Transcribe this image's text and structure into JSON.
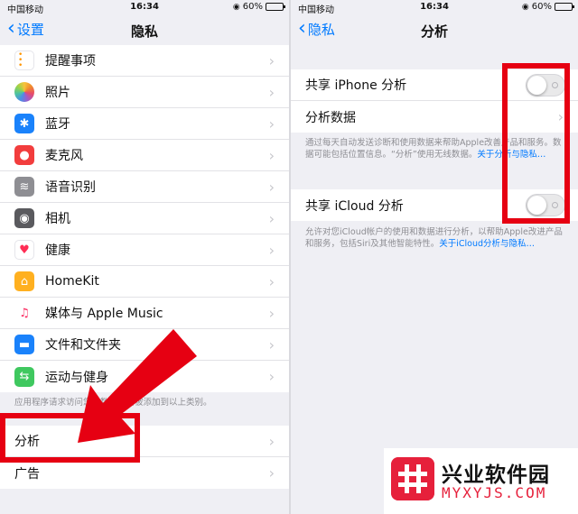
{
  "status_bar": {
    "left_panel": {
      "carrier": "中国移动",
      "time": "16:34",
      "battery": "60%",
      "battery_level": 0.6
    },
    "right_panel": {
      "carrier": "中国移动",
      "time": "16:34",
      "battery": "60%",
      "battery_level": 0.6
    }
  },
  "left_screen": {
    "back_label": "设置",
    "title": "隐私",
    "items": [
      {
        "label": "提醒事项",
        "icon": "reminders-icon",
        "color": "#ffffff"
      },
      {
        "label": "照片",
        "icon": "photos-icon",
        "color": "#ffffff"
      },
      {
        "label": "蓝牙",
        "icon": "bluetooth-icon",
        "color": "#1a82fb",
        "glyph": "✱"
      },
      {
        "label": "麦克风",
        "icon": "microphone-icon",
        "color": "#f23d3d",
        "glyph": "●"
      },
      {
        "label": "语音识别",
        "icon": "speech-recognition-icon",
        "color": "#8e8e93",
        "glyph": "≋"
      },
      {
        "label": "相机",
        "icon": "camera-icon",
        "color": "#5a5a5e",
        "glyph": "◉"
      },
      {
        "label": "健康",
        "icon": "health-icon",
        "color": "#ffffff",
        "glyph": "♥"
      },
      {
        "label": "HomeKit",
        "icon": "homekit-icon",
        "color": "#ffb020",
        "glyph": "⌂"
      },
      {
        "label": "媒体与 Apple Music",
        "icon": "music-icon",
        "color": "#ffffff",
        "glyph": "♫"
      },
      {
        "label": "文件和文件夹",
        "icon": "files-icon",
        "color": "#1a82fb",
        "glyph": "▬"
      },
      {
        "label": "运动与健身",
        "icon": "fitness-icon",
        "color": "#3fc85f",
        "glyph": "⇆"
      }
    ],
    "footnote": "应用程序请求访问您的数据时会被添加到以上类别。",
    "bottom_items": [
      {
        "label": "分析"
      },
      {
        "label": "广告"
      }
    ]
  },
  "right_screen": {
    "back_label": "隐私",
    "title": "分析",
    "group1": {
      "share_iphone_label": "共享 iPhone 分析",
      "share_iphone_on": false,
      "analytics_data_label": "分析数据"
    },
    "group1_footnote": {
      "text": "通过每天自动发送诊断和使用数据来帮助Apple改善产品和服务。数据可能包括位置信息。“分析”使用无线数据。",
      "link": "关于分析与隐私…"
    },
    "group2": {
      "share_icloud_label": "共享 iCloud 分析",
      "share_icloud_on": false
    },
    "group2_footnote": {
      "text": "允许对您iCloud帐户的使用和数据进行分析，以帮助Apple改进产品和服务，包括Siri及其他智能特性。",
      "link": "关于iCloud分析与隐私…"
    }
  },
  "watermark": {
    "name": "兴业软件园",
    "domain": "MYXYJS.COM"
  },
  "colors": {
    "ios_blue": "#007aff",
    "annotation_red": "#e60012",
    "watermark_red": "#e6203b"
  }
}
